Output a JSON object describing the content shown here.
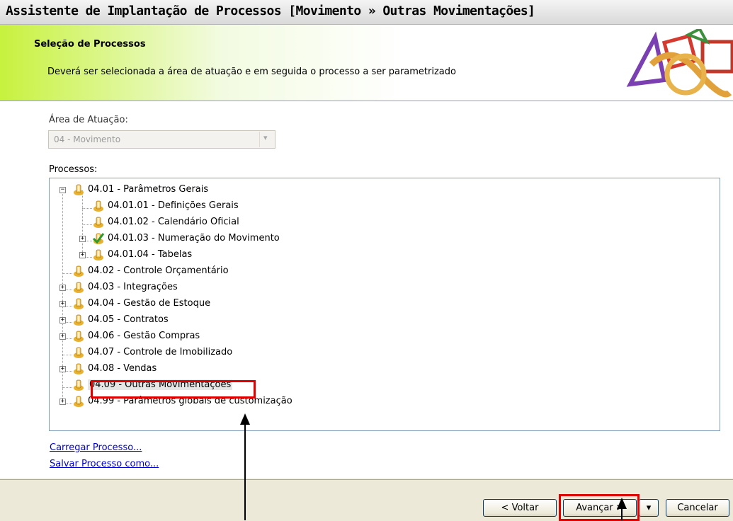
{
  "window": {
    "title": "Assistente de Implantação de Processos [Movimento » Outras Movimentações]"
  },
  "header": {
    "title": "Seleção de Processos",
    "description": "Deverá ser selecionada a área de atuação e em seguida o processo a ser parametrizado"
  },
  "area": {
    "label": "Área de Atuação:",
    "selected": "04 - Movimento"
  },
  "processes": {
    "label": "Processos:",
    "items": [
      {
        "text": "04.01 - Parâmetros Gerais",
        "expander": "minus",
        "checked": false
      },
      {
        "text": "04.01.01 - Definições Gerais",
        "expander": "",
        "checked": false
      },
      {
        "text": "04.01.02 - Calendário Oficial",
        "expander": "",
        "checked": false
      },
      {
        "text": "04.01.03 - Numeração do Movimento",
        "expander": "plus",
        "checked": true
      },
      {
        "text": "04.01.04 - Tabelas",
        "expander": "plus",
        "checked": false
      },
      {
        "text": "04.02 - Controle Orçamentário",
        "expander": "",
        "checked": false
      },
      {
        "text": "04.03 - Integrações",
        "expander": "plus",
        "checked": false
      },
      {
        "text": "04.04 - Gestão de Estoque",
        "expander": "plus",
        "checked": false
      },
      {
        "text": "04.05 - Contratos",
        "expander": "plus",
        "checked": false
      },
      {
        "text": "04.06 - Gestão Compras",
        "expander": "plus",
        "checked": false
      },
      {
        "text": "04.07 - Controle de Imobilizado",
        "expander": "",
        "checked": false
      },
      {
        "text": "04.08 - Vendas",
        "expander": "plus",
        "checked": false
      },
      {
        "text": "04.09 - Outras Movimentações",
        "expander": "",
        "checked": false,
        "selected": true
      },
      {
        "text": "04.99 - Parâmetros globais de customização",
        "expander": "plus",
        "checked": false
      }
    ]
  },
  "links": {
    "load": "Carregar Processo...",
    "save": "Salvar Processo como..."
  },
  "buttons": {
    "back": "< Voltar",
    "next": "Avançar >",
    "cancel": "Cancelar"
  },
  "colors": {
    "header_accent": "#c7f23e",
    "highlight": "#e00000",
    "link": "#0000cc"
  }
}
